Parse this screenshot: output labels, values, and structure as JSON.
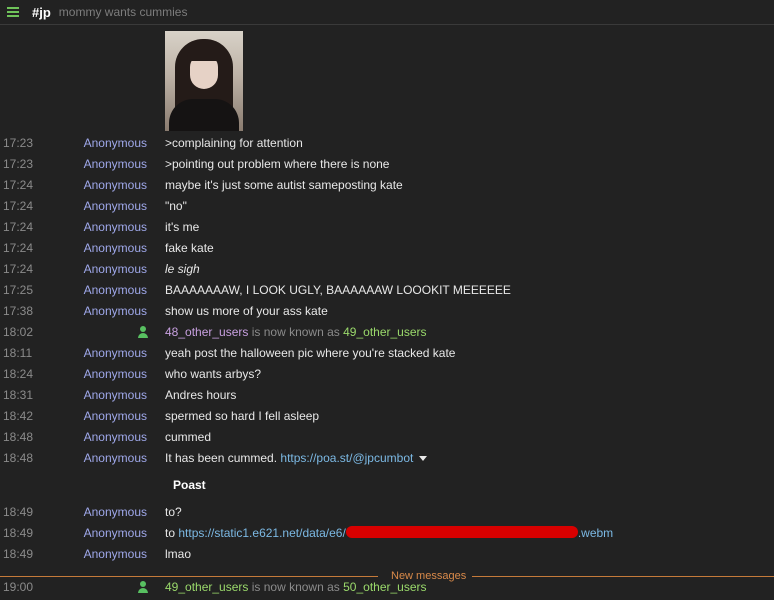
{
  "header": {
    "channel": "#jp",
    "topic": "mommy wants cummies"
  },
  "messages": [
    {
      "time": "17:23",
      "nick": "Anonymous",
      "text": ">complaining for attention"
    },
    {
      "time": "17:23",
      "nick": "Anonymous",
      "text": ">pointing out problem where there is none"
    },
    {
      "time": "17:24",
      "nick": "Anonymous",
      "text": "maybe it's just some autist sameposting kate"
    },
    {
      "time": "17:24",
      "nick": "Anonymous",
      "text": "\"no\""
    },
    {
      "time": "17:24",
      "nick": "Anonymous",
      "text": "it's me"
    },
    {
      "time": "17:24",
      "nick": "Anonymous",
      "text": "fake kate"
    },
    {
      "time": "17:24",
      "nick": "Anonymous",
      "text": "le sigh"
    },
    {
      "time": "17:25",
      "nick": "Anonymous",
      "text": "BAAAAAAAW, I LOOK UGLY, BAAAAAAW LOOOKIT MEEEEEE"
    },
    {
      "time": "17:38",
      "nick": "Anonymous",
      "text": "show us more of your ass kate"
    },
    {
      "time": "18:02",
      "old_nick": "48_other_users",
      "nick_change_text": "is now known as",
      "new_nick": "49_other_users"
    },
    {
      "time": "18:11",
      "nick": "Anonymous",
      "text": "yeah post the halloween pic where you're stacked kate"
    },
    {
      "time": "18:24",
      "nick": "Anonymous",
      "text": "who wants arbys?"
    },
    {
      "time": "18:31",
      "nick": "Anonymous",
      "text": "Andres hours"
    },
    {
      "time": "18:42",
      "nick": "Anonymous",
      "text": "spermed so hard I fell asleep"
    },
    {
      "time": "18:48",
      "nick": "Anonymous",
      "text": "cummed"
    },
    {
      "time": "18:48",
      "nick": "Anonymous",
      "text": "It has been cummed.",
      "link": "https://poa.st/@jpcumbot"
    },
    {
      "time": "18:49",
      "nick": "Anonymous",
      "text": "to?"
    },
    {
      "time": "18:49",
      "nick": "Anonymous",
      "text": "to",
      "link_prefix": "https://static1.e621.net/data/e6/",
      "link_suffix": ".webm"
    },
    {
      "time": "18:49",
      "nick": "Anonymous",
      "text": "lmao"
    },
    {
      "time": "19:00",
      "old_nick": "49_other_users",
      "nick_change_text": "is now known as",
      "new_nick": "50_other_users"
    }
  ],
  "preview": {
    "title": "Poast"
  },
  "divider": {
    "label": "New messages"
  },
  "colors": {
    "background": "#222222",
    "accent_green": "#6fc35a",
    "nick": "#9fa8ea",
    "link": "#7cb9e4",
    "new_messages": "#d98a4a",
    "redaction": "#d80000"
  },
  "icons": {
    "menu": "hamburger-icon",
    "user": "user-icon",
    "expand": "caret-down-icon"
  }
}
